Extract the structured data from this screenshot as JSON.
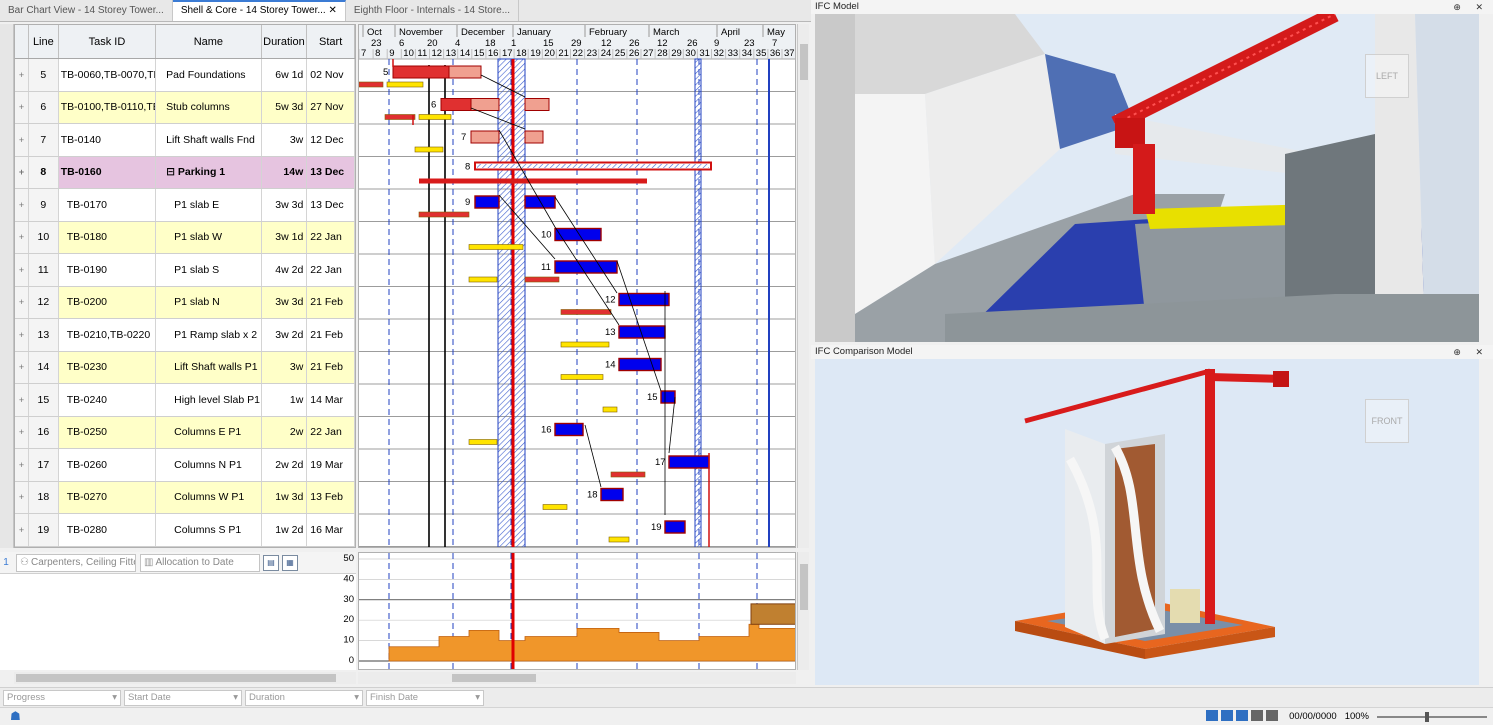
{
  "doc_tabs": [
    {
      "label": "Bar Chart View - 14 Storey Tower...",
      "active": false
    },
    {
      "label": "Shell & Core - 14 Storey Tower...",
      "active": true
    },
    {
      "label": "Eighth Floor - Internals - 14 Store...",
      "active": false
    }
  ],
  "tab_close": "✕",
  "grid": {
    "headers": {
      "line": "Line",
      "task_id": "Task ID",
      "name": "Name",
      "duration": "Duration",
      "start": "Start"
    },
    "rows": [
      {
        "line": "5",
        "task": "TB-0060,TB-0070,TB",
        "name": "Pad Foundations",
        "dur": "6w 1d",
        "start": "02 Nov",
        "style": "plain",
        "child": false
      },
      {
        "line": "6",
        "task": "TB-0100,TB-0110,TB",
        "name": "Stub columns",
        "dur": "5w 3d",
        "start": "27 Nov",
        "style": "alt",
        "child": false
      },
      {
        "line": "7",
        "task": "TB-0140",
        "name": "Lift Shaft walls Fnd",
        "dur": "3w",
        "start": "12 Dec",
        "style": "plain",
        "child": false
      },
      {
        "line": "8",
        "task": "TB-0160",
        "name": "⊟ Parking 1",
        "dur": "14w",
        "start": "13 Dec",
        "style": "summary",
        "child": false
      },
      {
        "line": "9",
        "task": "TB-0170",
        "name": "P1 slab E",
        "dur": "3w 3d",
        "start": "13 Dec",
        "style": "plain",
        "child": true
      },
      {
        "line": "10",
        "task": "TB-0180",
        "name": "P1 slab W",
        "dur": "3w 1d",
        "start": "22 Jan",
        "style": "alt",
        "child": true
      },
      {
        "line": "11",
        "task": "TB-0190",
        "name": "P1 slab S",
        "dur": "4w 2d",
        "start": "22 Jan",
        "style": "plain",
        "child": true
      },
      {
        "line": "12",
        "task": "TB-0200",
        "name": "P1 slab N",
        "dur": "3w 3d",
        "start": "21 Feb",
        "style": "alt",
        "child": true
      },
      {
        "line": "13",
        "task": "TB-0210,TB-0220",
        "name": "P1 Ramp slab x 2",
        "dur": "3w 2d",
        "start": "21 Feb",
        "style": "plain",
        "child": true
      },
      {
        "line": "14",
        "task": "TB-0230",
        "name": "Lift Shaft walls P1",
        "dur": "3w",
        "start": "21 Feb",
        "style": "alt",
        "child": true
      },
      {
        "line": "15",
        "task": "TB-0240",
        "name": "High level Slab P1",
        "dur": "1w",
        "start": "14 Mar",
        "style": "plain",
        "child": true
      },
      {
        "line": "16",
        "task": "TB-0250",
        "name": "Columns E P1",
        "dur": "2w",
        "start": "22 Jan",
        "style": "alt",
        "child": true
      },
      {
        "line": "17",
        "task": "TB-0260",
        "name": "Columns N P1",
        "dur": "2w 2d",
        "start": "19 Mar",
        "style": "plain",
        "child": true
      },
      {
        "line": "18",
        "task": "TB-0270",
        "name": "Columns W P1",
        "dur": "1w 3d",
        "start": "13 Feb",
        "style": "alt",
        "child": true
      },
      {
        "line": "19",
        "task": "TB-0280",
        "name": "Columns S P1",
        "dur": "1w 2d",
        "start": "16 Mar",
        "style": "plain",
        "child": true
      }
    ]
  },
  "timeline": {
    "months": [
      "Oct",
      "November",
      "December",
      "January",
      "February",
      "March",
      "April",
      "May"
    ],
    "dates": [
      "23",
      "6",
      "20",
      "4",
      "18",
      "1",
      "15",
      "29",
      "12",
      "26",
      "12",
      "26",
      "9",
      "23",
      "7"
    ],
    "weeks": [
      "7",
      "8",
      "9",
      "10",
      "11",
      "12",
      "13",
      "14",
      "15",
      "16",
      "17",
      "18",
      "19",
      "20",
      "21",
      "22",
      "23",
      "24",
      "25",
      "26",
      "27",
      "28",
      "29",
      "30",
      "31",
      "32",
      "33",
      "34",
      "35",
      "36",
      "37"
    ]
  },
  "histogram": {
    "toolbar_index": "1",
    "resource": "Carpenters, Ceiling Fitte",
    "mode": "Allocation to Date",
    "y_ticks": [
      "50",
      "40",
      "30",
      "20",
      "10",
      "0"
    ]
  },
  "ifc_model": {
    "title": "IFC Model",
    "cube_label": "LEFT"
  },
  "ifc_comparison": {
    "title": "IFC Comparison Model",
    "cube_label": "FRONT"
  },
  "pane_buttons": "⊕ ✕",
  "filters": [
    {
      "placeholder": "Progress"
    },
    {
      "placeholder": "Start Date"
    },
    {
      "placeholder": "Duration"
    },
    {
      "placeholder": "Finish Date"
    }
  ],
  "status": {
    "date": "00/00/0000",
    "zoom": "100%"
  },
  "colors": {
    "bar_blue": "#0000ee",
    "bar_red": "#e03030",
    "bar_salmon": "#f0a090",
    "bar_yellow": "#ffe400",
    "today_line": "#e00000",
    "hist_orange": "#f0962a"
  }
}
